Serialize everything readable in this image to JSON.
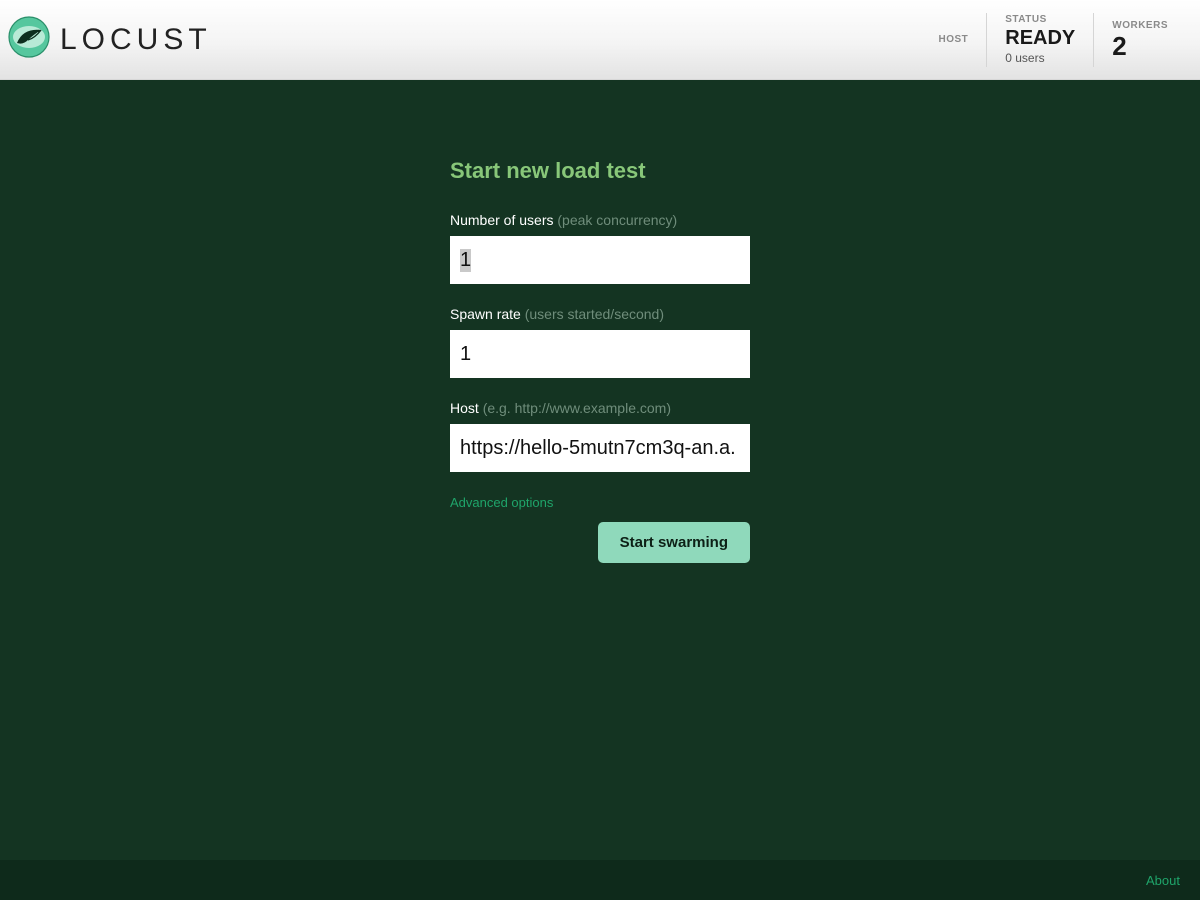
{
  "brand": {
    "name": "LOCUST"
  },
  "header": {
    "host_label": "HOST",
    "status_label": "STATUS",
    "status_value": "READY",
    "status_sub": "0 users",
    "workers_label": "WORKERS",
    "workers_value": "2"
  },
  "form": {
    "title": "Start new load test",
    "users_label": "Number of users",
    "users_hint": "(peak concurrency)",
    "users_value": "1",
    "spawn_label": "Spawn rate",
    "spawn_hint": "(users started/second)",
    "spawn_value": "1",
    "host_label": "Host",
    "host_hint": "(e.g. http://www.example.com)",
    "host_value": "https://hello-5mutn7cm3q-an.a.",
    "advanced_label": "Advanced options",
    "submit_label": "Start swarming"
  },
  "footer": {
    "about_label": "About"
  }
}
